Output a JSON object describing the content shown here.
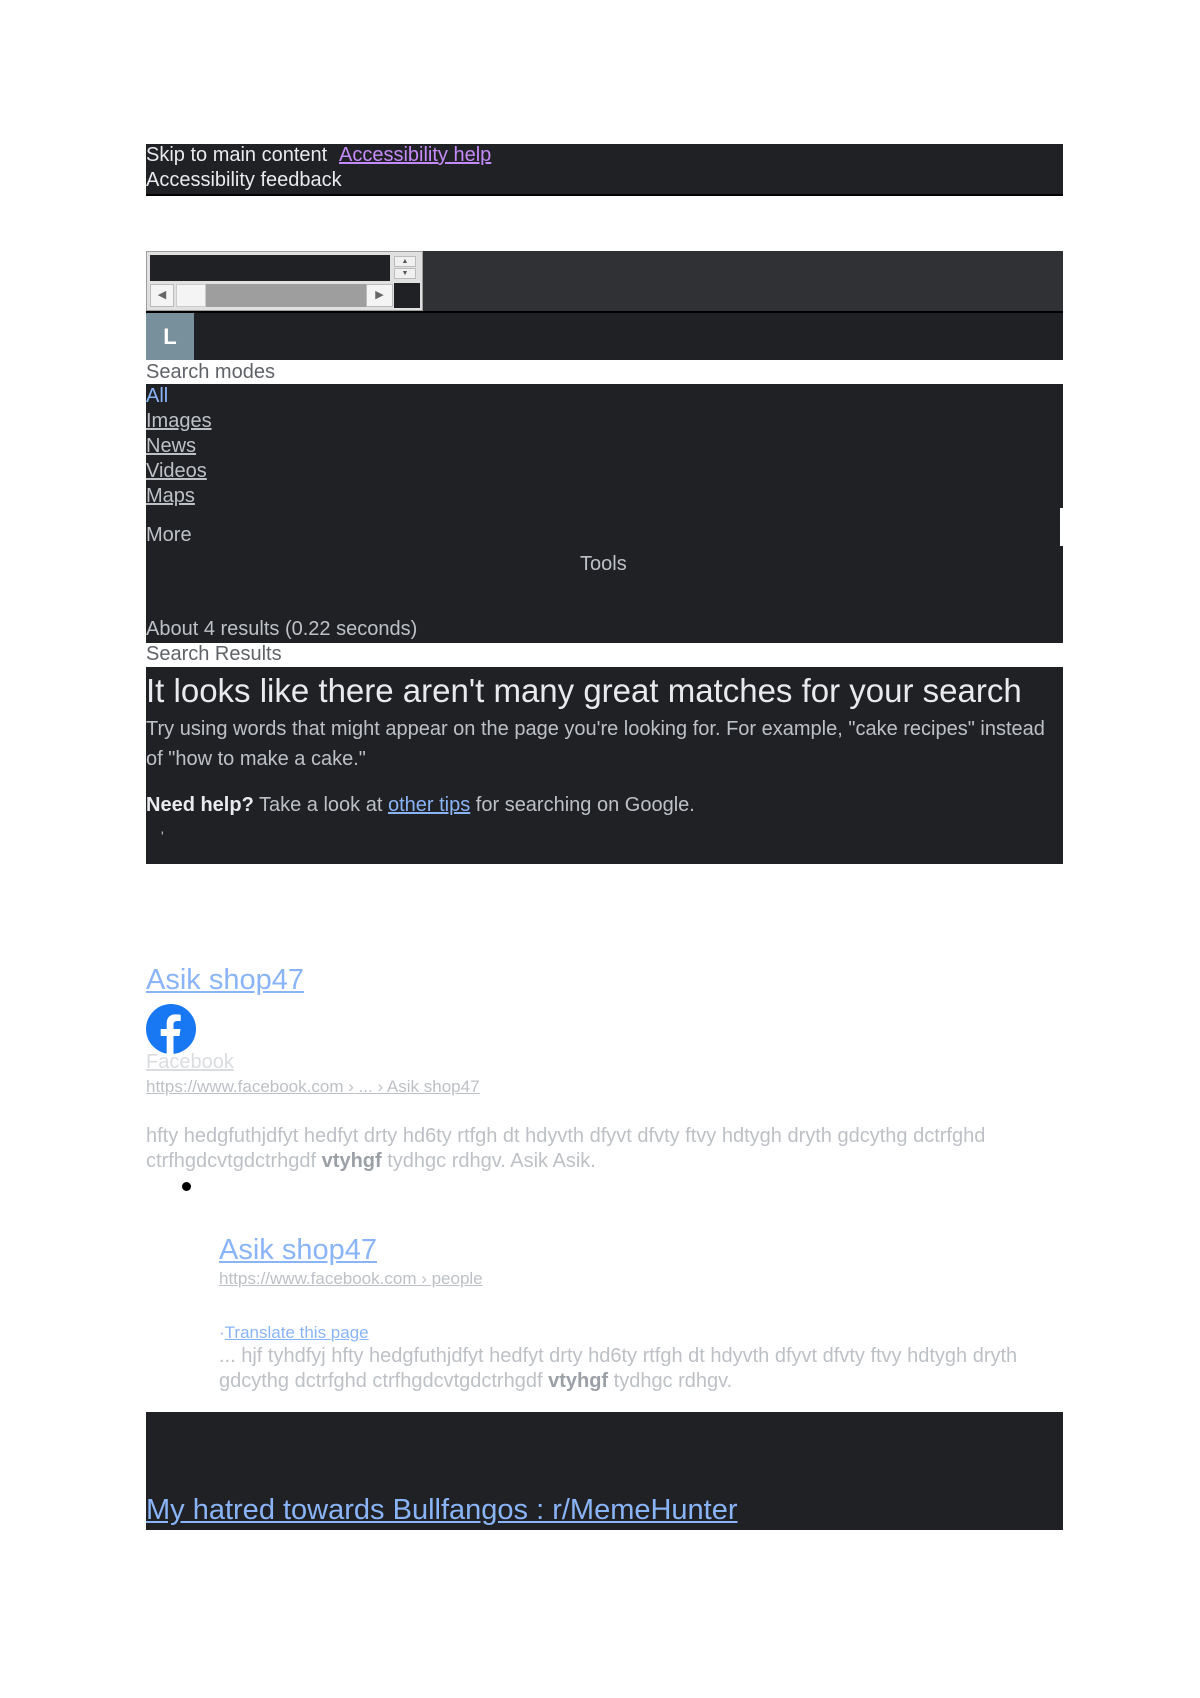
{
  "accessibility": {
    "skip_link": "Skip to main content",
    "help_link": "Accessibility help",
    "feedback": "Accessibility feedback"
  },
  "account": {
    "avatar_letter": "L"
  },
  "search_modes": {
    "label": "Search modes",
    "items": [
      "All",
      "Images",
      "News",
      "Videos",
      "Maps"
    ],
    "more": "More",
    "tools": "Tools"
  },
  "result_stats": "About 4 results (0.22 seconds)",
  "results_heading": "Search Results",
  "no_results": {
    "title": "It looks like there aren't many great matches for your search",
    "body": "Try using words that might appear on the page you're looking for. For example, \"cake recipes\" instead of \"how to make a cake.\"",
    "help_bold": "Need help?",
    "help_pre": " Take a look at ",
    "help_link": "other tips",
    "help_post": " for searching on Google.",
    "dot": "'"
  },
  "results": [
    {
      "title": "Asik shop47",
      "site": "Facebook",
      "url": "https://www.facebook.com › ... › Asik shop47",
      "snippet_pre": "hfty hedgfuthjdfyt hedfyt drty hd6ty rtfgh dt hdyvth dfyvt dfvty ftvy hdtygh dryth gdcythg dctrfghd ctrfhgdcvtgdctrhgdf ",
      "snippet_bold": "vtyhgf",
      "snippet_post": " tydhgc rdhgv. Asik Asik."
    },
    {
      "title": "Asik shop47",
      "url": "https://www.facebook.com › people",
      "translate_prefix": "·",
      "translate": "Translate this page",
      "snippet_pre": "... hjf tyhdfyj hfty hedgfuthjdfyt hedfyt drty hd6ty rtfgh dt hdyvth dfyvt dfvty ftvy hdtygh dryth gdcythg dctrfghd ctrfhgdcvtgdctrhgdf ",
      "snippet_bold": "vtyhgf",
      "snippet_post": " tydhgc rdhgv."
    },
    {
      "title": "My hatred towards Bullfangos : r/MemeHunter"
    }
  ],
  "colors": {
    "background_dark": "#202124",
    "link_blue": "#8ab4f8",
    "visited_purple": "#c58af9",
    "facebook_blue": "#1877f2"
  },
  "icons": {
    "site_favicon": "facebook-icon"
  }
}
